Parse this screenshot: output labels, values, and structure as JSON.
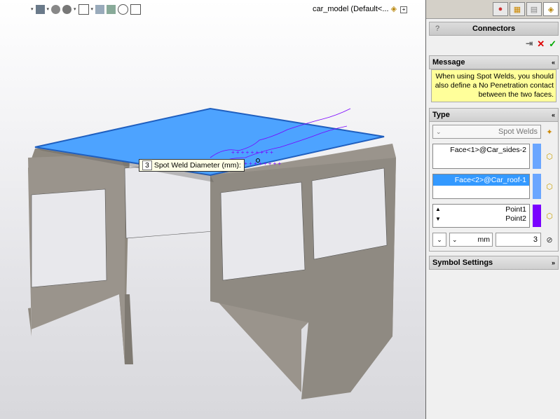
{
  "document": {
    "title": "car_model (Default<..."
  },
  "tooltip": {
    "label": "Spot Weld Diameter (mm):",
    "value": "3"
  },
  "panel": {
    "title": "Connectors",
    "help": "?",
    "actions": {
      "ok": "✓",
      "cancel": "✕",
      "pin": "⇥"
    },
    "message": {
      "header": "Message",
      "text": "When using Spot Welds, you should also define a No Penetration contact between the two faces."
    },
    "type": {
      "header": "Type",
      "connector_type": "Spot Welds",
      "face1": "Face<1>@Car_sides-2",
      "face2": "Face<2>@Car_roof-1",
      "points": [
        "Point1",
        "Point2"
      ],
      "diameter": "3",
      "unit": "mm"
    },
    "symbol": {
      "header": "Symbol Settings"
    }
  },
  "colors": {
    "accent_blue": "#3399ff",
    "face1_bar": "#6aa6ff",
    "points_bar": "#7a00ff",
    "roof": "#4da3ff",
    "body": "#9a948c"
  }
}
